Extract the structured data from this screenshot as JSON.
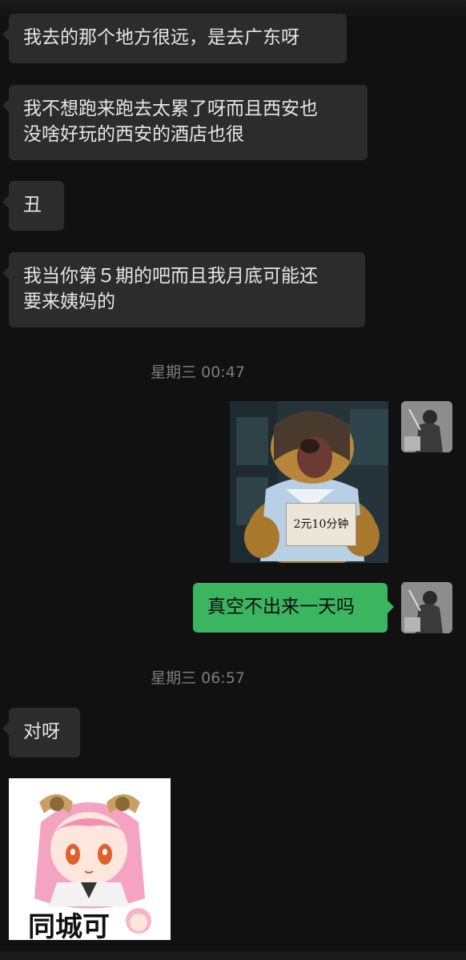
{
  "messages": [
    {
      "text": "我去的那个地方很远，是去广东呀"
    },
    {
      "lines": [
        "我不想跑来跑去太累了呀而且西安也",
        "没啥好玩的西安的酒店也很"
      ]
    },
    {
      "text": "丑"
    },
    {
      "lines": [
        "我当你第５期的吧而且我月底可能还",
        "要来姨妈的"
      ]
    },
    {
      "text": "真空不出来一天吗"
    },
    {
      "text": "对呀"
    }
  ],
  "timestamps": [
    "星期三 00:47",
    "星期三 06:57"
  ],
  "stickers": {
    "bear_sign": "2元10分钟",
    "girl_caption": "同城可"
  },
  "colors": {
    "background": "#111111",
    "incoming_bubble": "#2c2c2c",
    "outgoing_bubble": "#3bb55f"
  }
}
